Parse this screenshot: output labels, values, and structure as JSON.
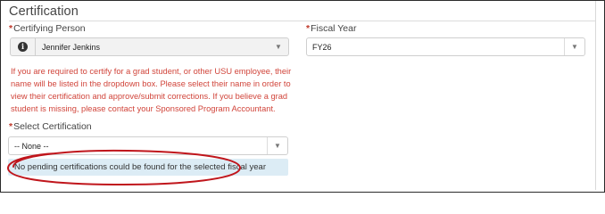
{
  "section": {
    "title": "Certification"
  },
  "certifying_person": {
    "required_mark": "*",
    "label": "Certifying Person",
    "info_icon": "info-circle-icon",
    "selected": "Jennifer Jenkins",
    "chevron_icon": "chevron-down-icon"
  },
  "fiscal_year": {
    "required_mark": "*",
    "label": "Fiscal Year",
    "selected": "FY26",
    "chevron_icon": "chevron-down-icon"
  },
  "help_text": "If you are required to certify for a grad student, or other USU employee, their name will be listed in the dropdown box. Please select their name in order to view their certification and approve/submit corrections. If you believe a grad student is missing, please contact your Sponsored Program Accountant.",
  "select_certification": {
    "required_mark": "*",
    "label": "Select Certification",
    "selected": "-- None --",
    "chevron_icon": "chevron-down-icon"
  },
  "alert": {
    "message": "No pending certifications could be found for the selected fiscal year"
  },
  "colors": {
    "required": "#c0392b",
    "help_text": "#d1453b",
    "alert_bg": "#dcecf5",
    "annotation": "#c0161c"
  }
}
